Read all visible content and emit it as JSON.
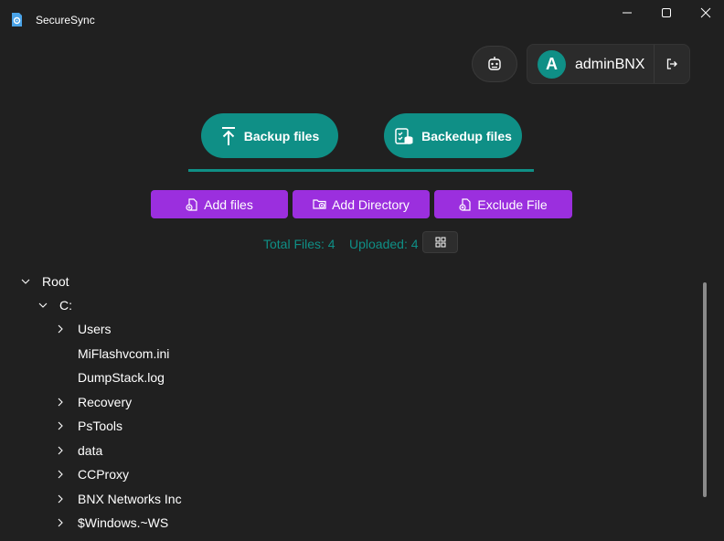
{
  "app": {
    "title": "SecureSync"
  },
  "user": {
    "avatar_letter": "A",
    "name": "adminBNX"
  },
  "tabs": [
    {
      "label": "Backup files"
    },
    {
      "label": "Backedup files"
    }
  ],
  "actions": [
    {
      "label": "Add files"
    },
    {
      "label": "Add Directory"
    },
    {
      "label": "Exclude File"
    }
  ],
  "stats": {
    "total_files": "Total Files: 4",
    "uploaded": "Uploaded: 4"
  },
  "tree": {
    "root": "Root",
    "drive": "C:",
    "items": [
      {
        "label": "Users",
        "expandable": true
      },
      {
        "label": "MiFlashvcom.ini",
        "expandable": false
      },
      {
        "label": "DumpStack.log",
        "expandable": false
      },
      {
        "label": "Recovery",
        "expandable": true
      },
      {
        "label": "PsTools",
        "expandable": true
      },
      {
        "label": "data",
        "expandable": true
      },
      {
        "label": "CCProxy",
        "expandable": true
      },
      {
        "label": "BNX Networks Inc",
        "expandable": true
      },
      {
        "label": "$Windows.~WS",
        "expandable": true
      }
    ]
  },
  "colors": {
    "background": "#202020",
    "teal_accent": "#0f8f86",
    "purple_action": "#9b2fde"
  }
}
